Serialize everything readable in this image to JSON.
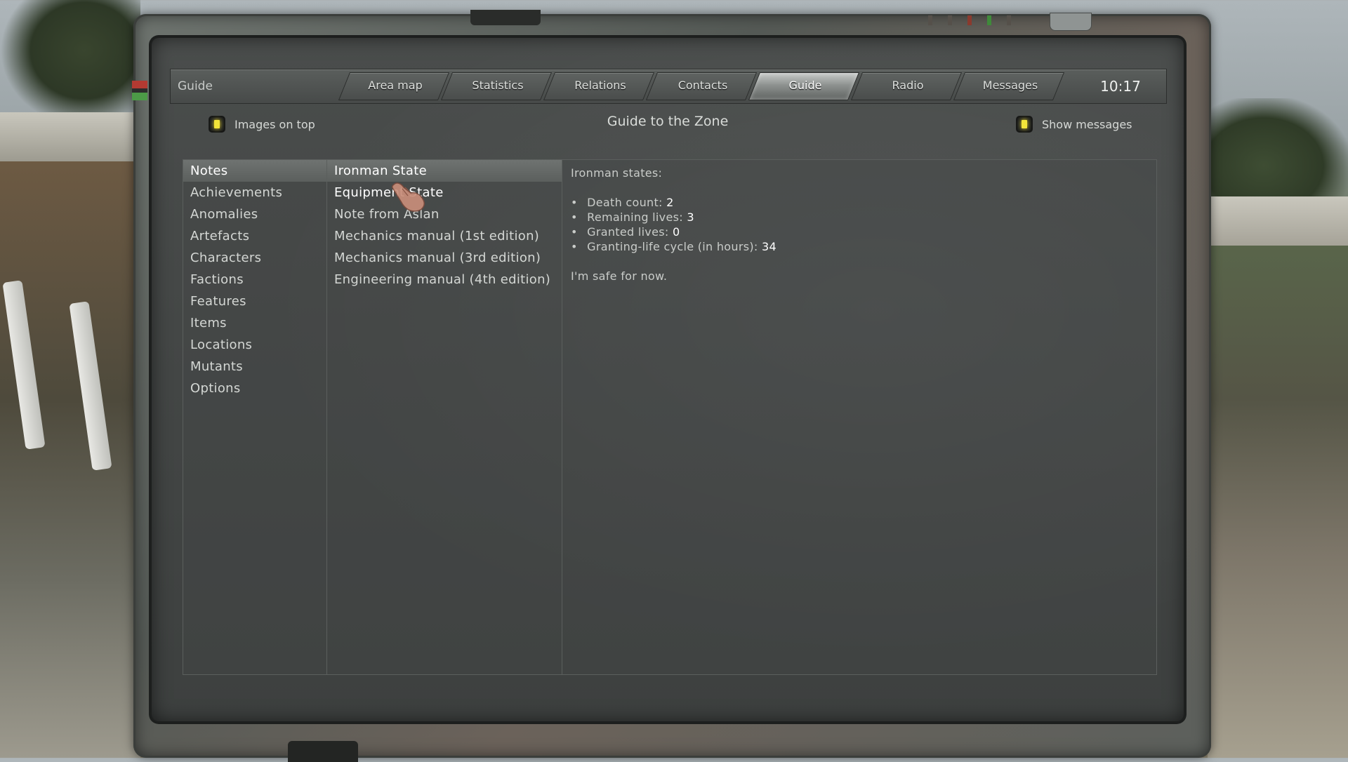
{
  "header": {
    "section_title": "Guide",
    "tabs": [
      {
        "label": "Area map"
      },
      {
        "label": "Statistics"
      },
      {
        "label": "Relations"
      },
      {
        "label": "Contacts"
      },
      {
        "label": "Guide",
        "active": true
      },
      {
        "label": "Radio"
      },
      {
        "label": "Messages"
      }
    ],
    "clock": "10:17"
  },
  "subheader": {
    "images_on_top_label": "Images on top",
    "title": "Guide to the Zone",
    "show_messages_label": "Show messages"
  },
  "categories": [
    "Notes",
    "Achievements",
    "Anomalies",
    "Artefacts",
    "Characters",
    "Factions",
    "Features",
    "Items",
    "Locations",
    "Mutants",
    "Options"
  ],
  "selected_category": "Notes",
  "entries": [
    "Ironman State",
    "Equipment State",
    "Note from Aslan",
    "Mechanics manual (1st edition)",
    "Mechanics manual (3rd edition)",
    "Engineering manual (4th edition)"
  ],
  "selected_entry": "Ironman State",
  "article": {
    "heading": "Ironman states:",
    "stats": [
      {
        "label": "Death count:",
        "value": "2"
      },
      {
        "label": "Remaining lives:",
        "value": "3"
      },
      {
        "label": "Granted lives:",
        "value": "0"
      },
      {
        "label": "Granting-life cycle (in hours):",
        "value": "34"
      }
    ],
    "closing": "I'm safe for now."
  },
  "colors": {
    "checkbox_lamp": "#f2e53a",
    "indicator_red": "#8a3a2e",
    "indicator_green": "#3f8a3a"
  }
}
